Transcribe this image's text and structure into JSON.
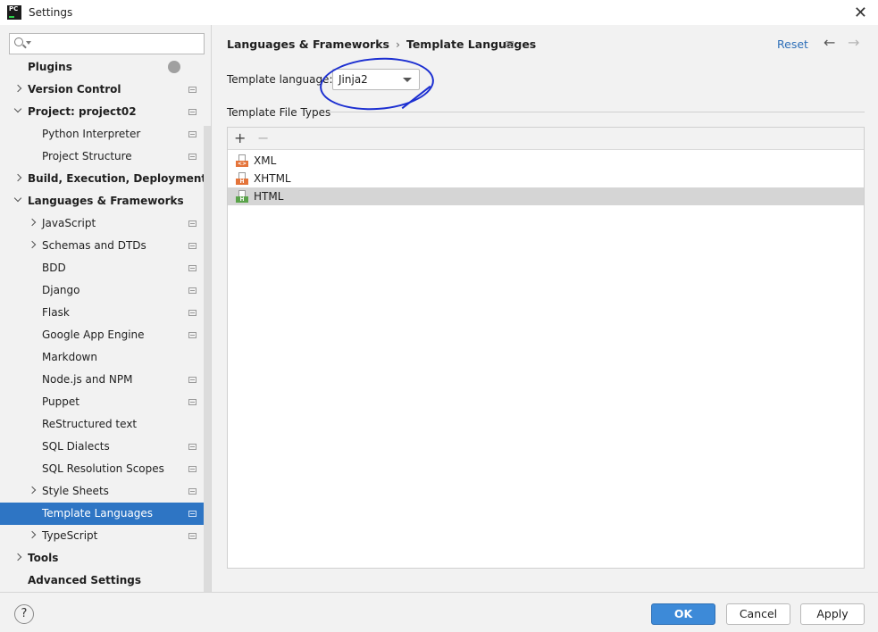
{
  "window": {
    "title": "Settings",
    "app_icon_text": "PC"
  },
  "sidebar": {
    "search_placeholder": "",
    "items": [
      {
        "label": "Plugins",
        "indent": 1,
        "bold": true,
        "arrow": "none",
        "badge": true,
        "proj": false,
        "selected": false
      },
      {
        "label": "Version Control",
        "indent": 1,
        "bold": true,
        "arrow": "right",
        "badge": false,
        "proj": true,
        "selected": false
      },
      {
        "label": "Project: project02",
        "indent": 1,
        "bold": true,
        "arrow": "down",
        "badge": false,
        "proj": true,
        "selected": false
      },
      {
        "label": "Python Interpreter",
        "indent": 2,
        "bold": false,
        "arrow": "none",
        "badge": false,
        "proj": true,
        "selected": false
      },
      {
        "label": "Project Structure",
        "indent": 2,
        "bold": false,
        "arrow": "none",
        "badge": false,
        "proj": true,
        "selected": false
      },
      {
        "label": "Build, Execution, Deployment",
        "indent": 1,
        "bold": true,
        "arrow": "right",
        "badge": false,
        "proj": false,
        "selected": false
      },
      {
        "label": "Languages & Frameworks",
        "indent": 1,
        "bold": true,
        "arrow": "down",
        "badge": false,
        "proj": false,
        "selected": false
      },
      {
        "label": "JavaScript",
        "indent": 2,
        "bold": false,
        "arrow": "right",
        "badge": false,
        "proj": true,
        "selected": false
      },
      {
        "label": "Schemas and DTDs",
        "indent": 2,
        "bold": false,
        "arrow": "right",
        "badge": false,
        "proj": true,
        "selected": false
      },
      {
        "label": "BDD",
        "indent": 2,
        "bold": false,
        "arrow": "none",
        "badge": false,
        "proj": true,
        "selected": false
      },
      {
        "label": "Django",
        "indent": 2,
        "bold": false,
        "arrow": "none",
        "badge": false,
        "proj": true,
        "selected": false
      },
      {
        "label": "Flask",
        "indent": 2,
        "bold": false,
        "arrow": "none",
        "badge": false,
        "proj": true,
        "selected": false
      },
      {
        "label": "Google App Engine",
        "indent": 2,
        "bold": false,
        "arrow": "none",
        "badge": false,
        "proj": true,
        "selected": false
      },
      {
        "label": "Markdown",
        "indent": 2,
        "bold": false,
        "arrow": "none",
        "badge": false,
        "proj": false,
        "selected": false
      },
      {
        "label": "Node.js and NPM",
        "indent": 2,
        "bold": false,
        "arrow": "none",
        "badge": false,
        "proj": true,
        "selected": false
      },
      {
        "label": "Puppet",
        "indent": 2,
        "bold": false,
        "arrow": "none",
        "badge": false,
        "proj": true,
        "selected": false
      },
      {
        "label": "ReStructured text",
        "indent": 2,
        "bold": false,
        "arrow": "none",
        "badge": false,
        "proj": false,
        "selected": false
      },
      {
        "label": "SQL Dialects",
        "indent": 2,
        "bold": false,
        "arrow": "none",
        "badge": false,
        "proj": true,
        "selected": false
      },
      {
        "label": "SQL Resolution Scopes",
        "indent": 2,
        "bold": false,
        "arrow": "none",
        "badge": false,
        "proj": true,
        "selected": false
      },
      {
        "label": "Style Sheets",
        "indent": 2,
        "bold": false,
        "arrow": "right",
        "badge": false,
        "proj": true,
        "selected": false
      },
      {
        "label": "Template Languages",
        "indent": 2,
        "bold": false,
        "arrow": "none",
        "badge": false,
        "proj": true,
        "selected": true
      },
      {
        "label": "TypeScript",
        "indent": 2,
        "bold": false,
        "arrow": "right",
        "badge": false,
        "proj": true,
        "selected": false
      },
      {
        "label": "Tools",
        "indent": 1,
        "bold": true,
        "arrow": "right",
        "badge": false,
        "proj": false,
        "selected": false
      },
      {
        "label": "Advanced Settings",
        "indent": 1,
        "bold": true,
        "arrow": "none",
        "badge": false,
        "proj": false,
        "selected": false
      }
    ]
  },
  "main": {
    "breadcrumb": [
      "Languages & Frameworks",
      "Template Languages"
    ],
    "breadcrumb_sep": "›",
    "reset_label": "Reset",
    "back_arrow": "←",
    "forward_arrow": "→",
    "template_language_label": "Template language:",
    "template_language_value": "Jinja2",
    "section_title": "Template File Types",
    "add_symbol": "+",
    "remove_symbol": "−",
    "file_types": [
      {
        "name": "XML",
        "tag": "<>",
        "color": "#e4743a",
        "selected": false
      },
      {
        "name": "XHTML",
        "tag": "H",
        "color": "#e4743a",
        "selected": false
      },
      {
        "name": "HTML",
        "tag": "H",
        "color": "#5aa34a",
        "selected": true
      }
    ]
  },
  "footer": {
    "help_label": "?",
    "ok_label": "OK",
    "cancel_label": "Cancel",
    "apply_label": "Apply"
  },
  "colors": {
    "selection": "#2e75c4",
    "link": "#2e6fb8",
    "annotation": "#1c2fd1"
  }
}
